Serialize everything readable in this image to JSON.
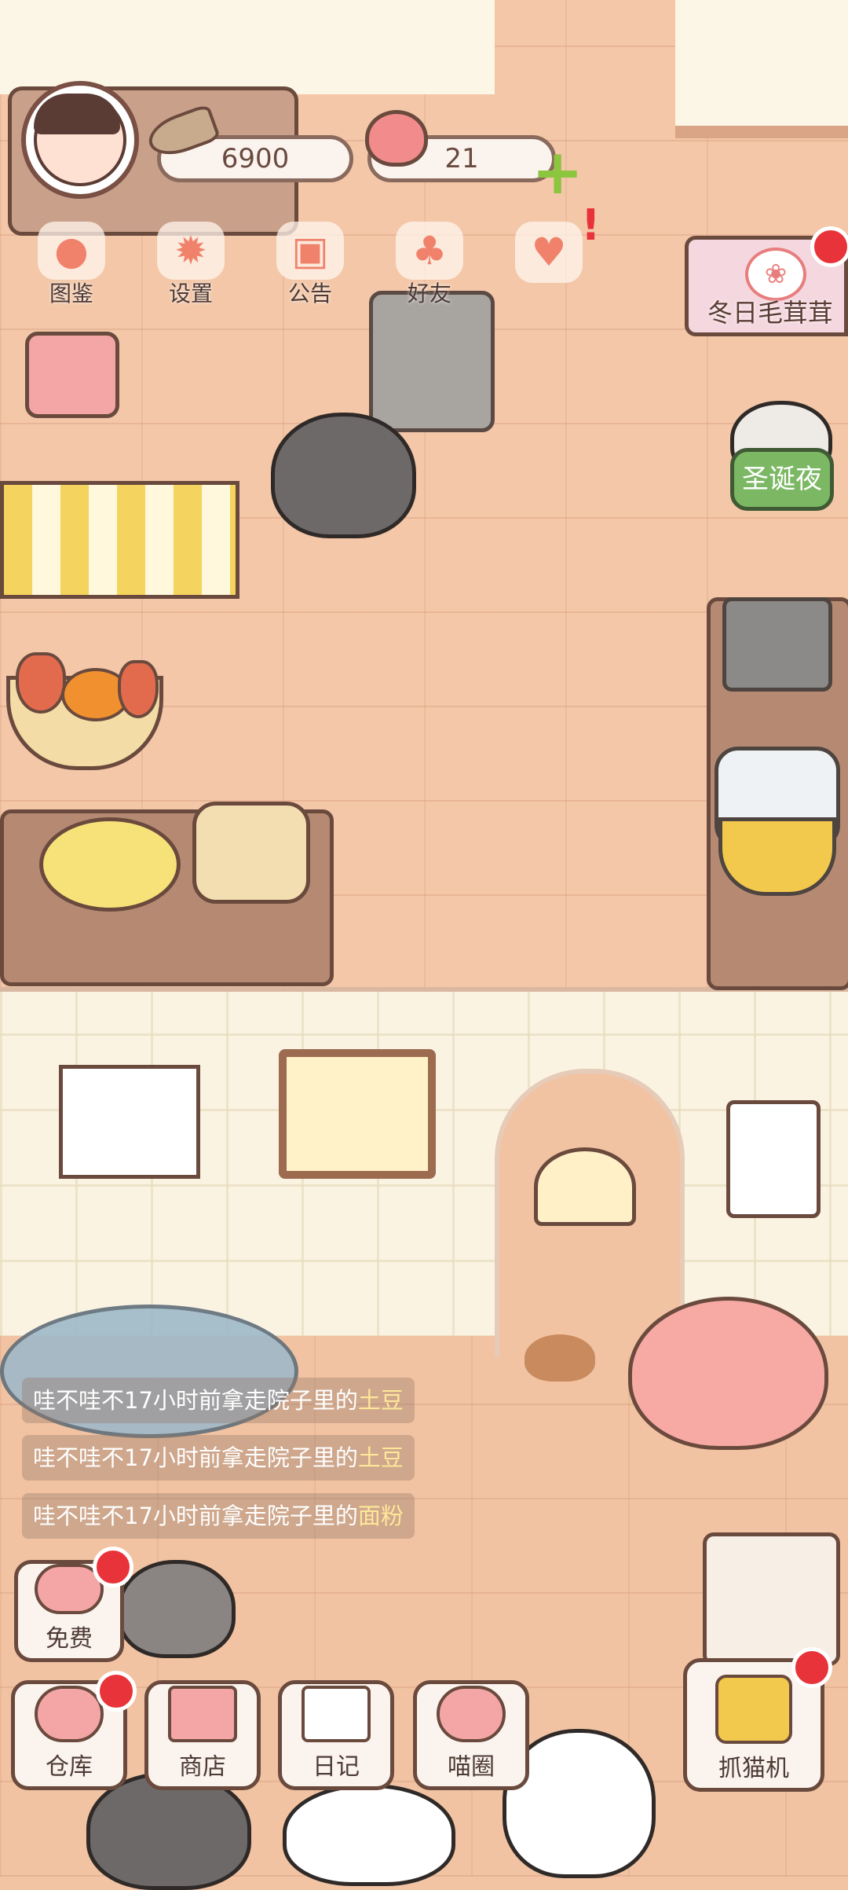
{
  "hud": {
    "coins": "6900",
    "hearts": "21",
    "add_symbol": "+"
  },
  "menu": [
    {
      "label": "图鉴",
      "icon": "cat-book-icon"
    },
    {
      "label": "设置",
      "icon": "gear-icon"
    },
    {
      "label": "公告",
      "icon": "gift-icon"
    },
    {
      "label": "好友",
      "icon": "friends-icon"
    },
    {
      "label": "",
      "icon": "heart-mail-icon",
      "alert": "!"
    }
  ],
  "event": {
    "title": "冬日毛茸茸"
  },
  "xmas": {
    "label": "圣诞夜"
  },
  "logs": [
    {
      "who": "哇不哇不",
      "text": "17小时前拿走院子里的",
      "item": "土豆"
    },
    {
      "who": "哇不哇不",
      "text": "17小时前拿走院子里的",
      "item": "土豆"
    },
    {
      "who": "哇不哇不",
      "text": "17小时前拿走院子里的",
      "item": "面粉"
    }
  ],
  "bottom": {
    "free": "免费",
    "warehouse": "仓库",
    "shop": "商店",
    "diary": "日记",
    "circle": "喵圈",
    "claw": "抓猫机"
  },
  "colors": {
    "accent_red": "#e8333a",
    "accent_green": "#8cc63f",
    "highlight_text": "#ffe79a"
  }
}
